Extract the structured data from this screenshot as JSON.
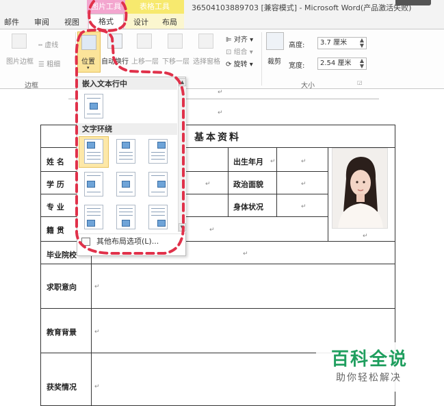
{
  "title_bar": {
    "picture_tools": "图片工具",
    "table_tools": "表格工具",
    "document_title": "36504103889703 [兼容模式] - Microsoft Word(产品激活失败)"
  },
  "tabs": [
    {
      "label": "邮件"
    },
    {
      "label": "审阅"
    },
    {
      "label": "视图"
    },
    {
      "label": "格式"
    },
    {
      "label": "设计"
    },
    {
      "label": "布局"
    }
  ],
  "ribbon": {
    "picture_border": "图片边框",
    "dashes": "虚线",
    "weight": "粗细",
    "group_border": "边框",
    "position": "位置",
    "wrap_text": "自动换行",
    "bring_forward": "上移一层",
    "send_backward": "下移一层",
    "selection_pane": "选择窗格",
    "align": "对齐",
    "group": "组合",
    "rotate": "旋转",
    "crop": "裁剪",
    "height_label": "高度:",
    "height_value": "3.7 厘米",
    "width_label": "宽度:",
    "width_value": "2.54 厘米",
    "group_size": "大小"
  },
  "dropdown": {
    "section_inline": "嵌入文本行中",
    "section_wrap": "文字环绕",
    "more_options": "其他布局选项(L)..."
  },
  "document": {
    "table_title": "基本资料",
    "labels": {
      "name": "姓 名",
      "education": "学 历",
      "major": "专 业",
      "native": "籍 贯",
      "school": "毕业院校",
      "birth": "出生年月",
      "political": "政治面貌",
      "health": "身体状况",
      "job_intent": "求职意向",
      "edu_background": "教育背景",
      "awards": "获奖情况"
    },
    "paragraph_mark": "↵"
  },
  "watermark": {
    "brand": "百科全说",
    "slogan": "助你轻松解决"
  },
  "colors": {
    "annotation_red": "#e0314a",
    "picture_tools_pink": "#f3a6cf",
    "table_tools_yellow": "#f7e96e",
    "watermark_green": "#1f9e5e",
    "selected_highlight": "#fbe49a"
  }
}
